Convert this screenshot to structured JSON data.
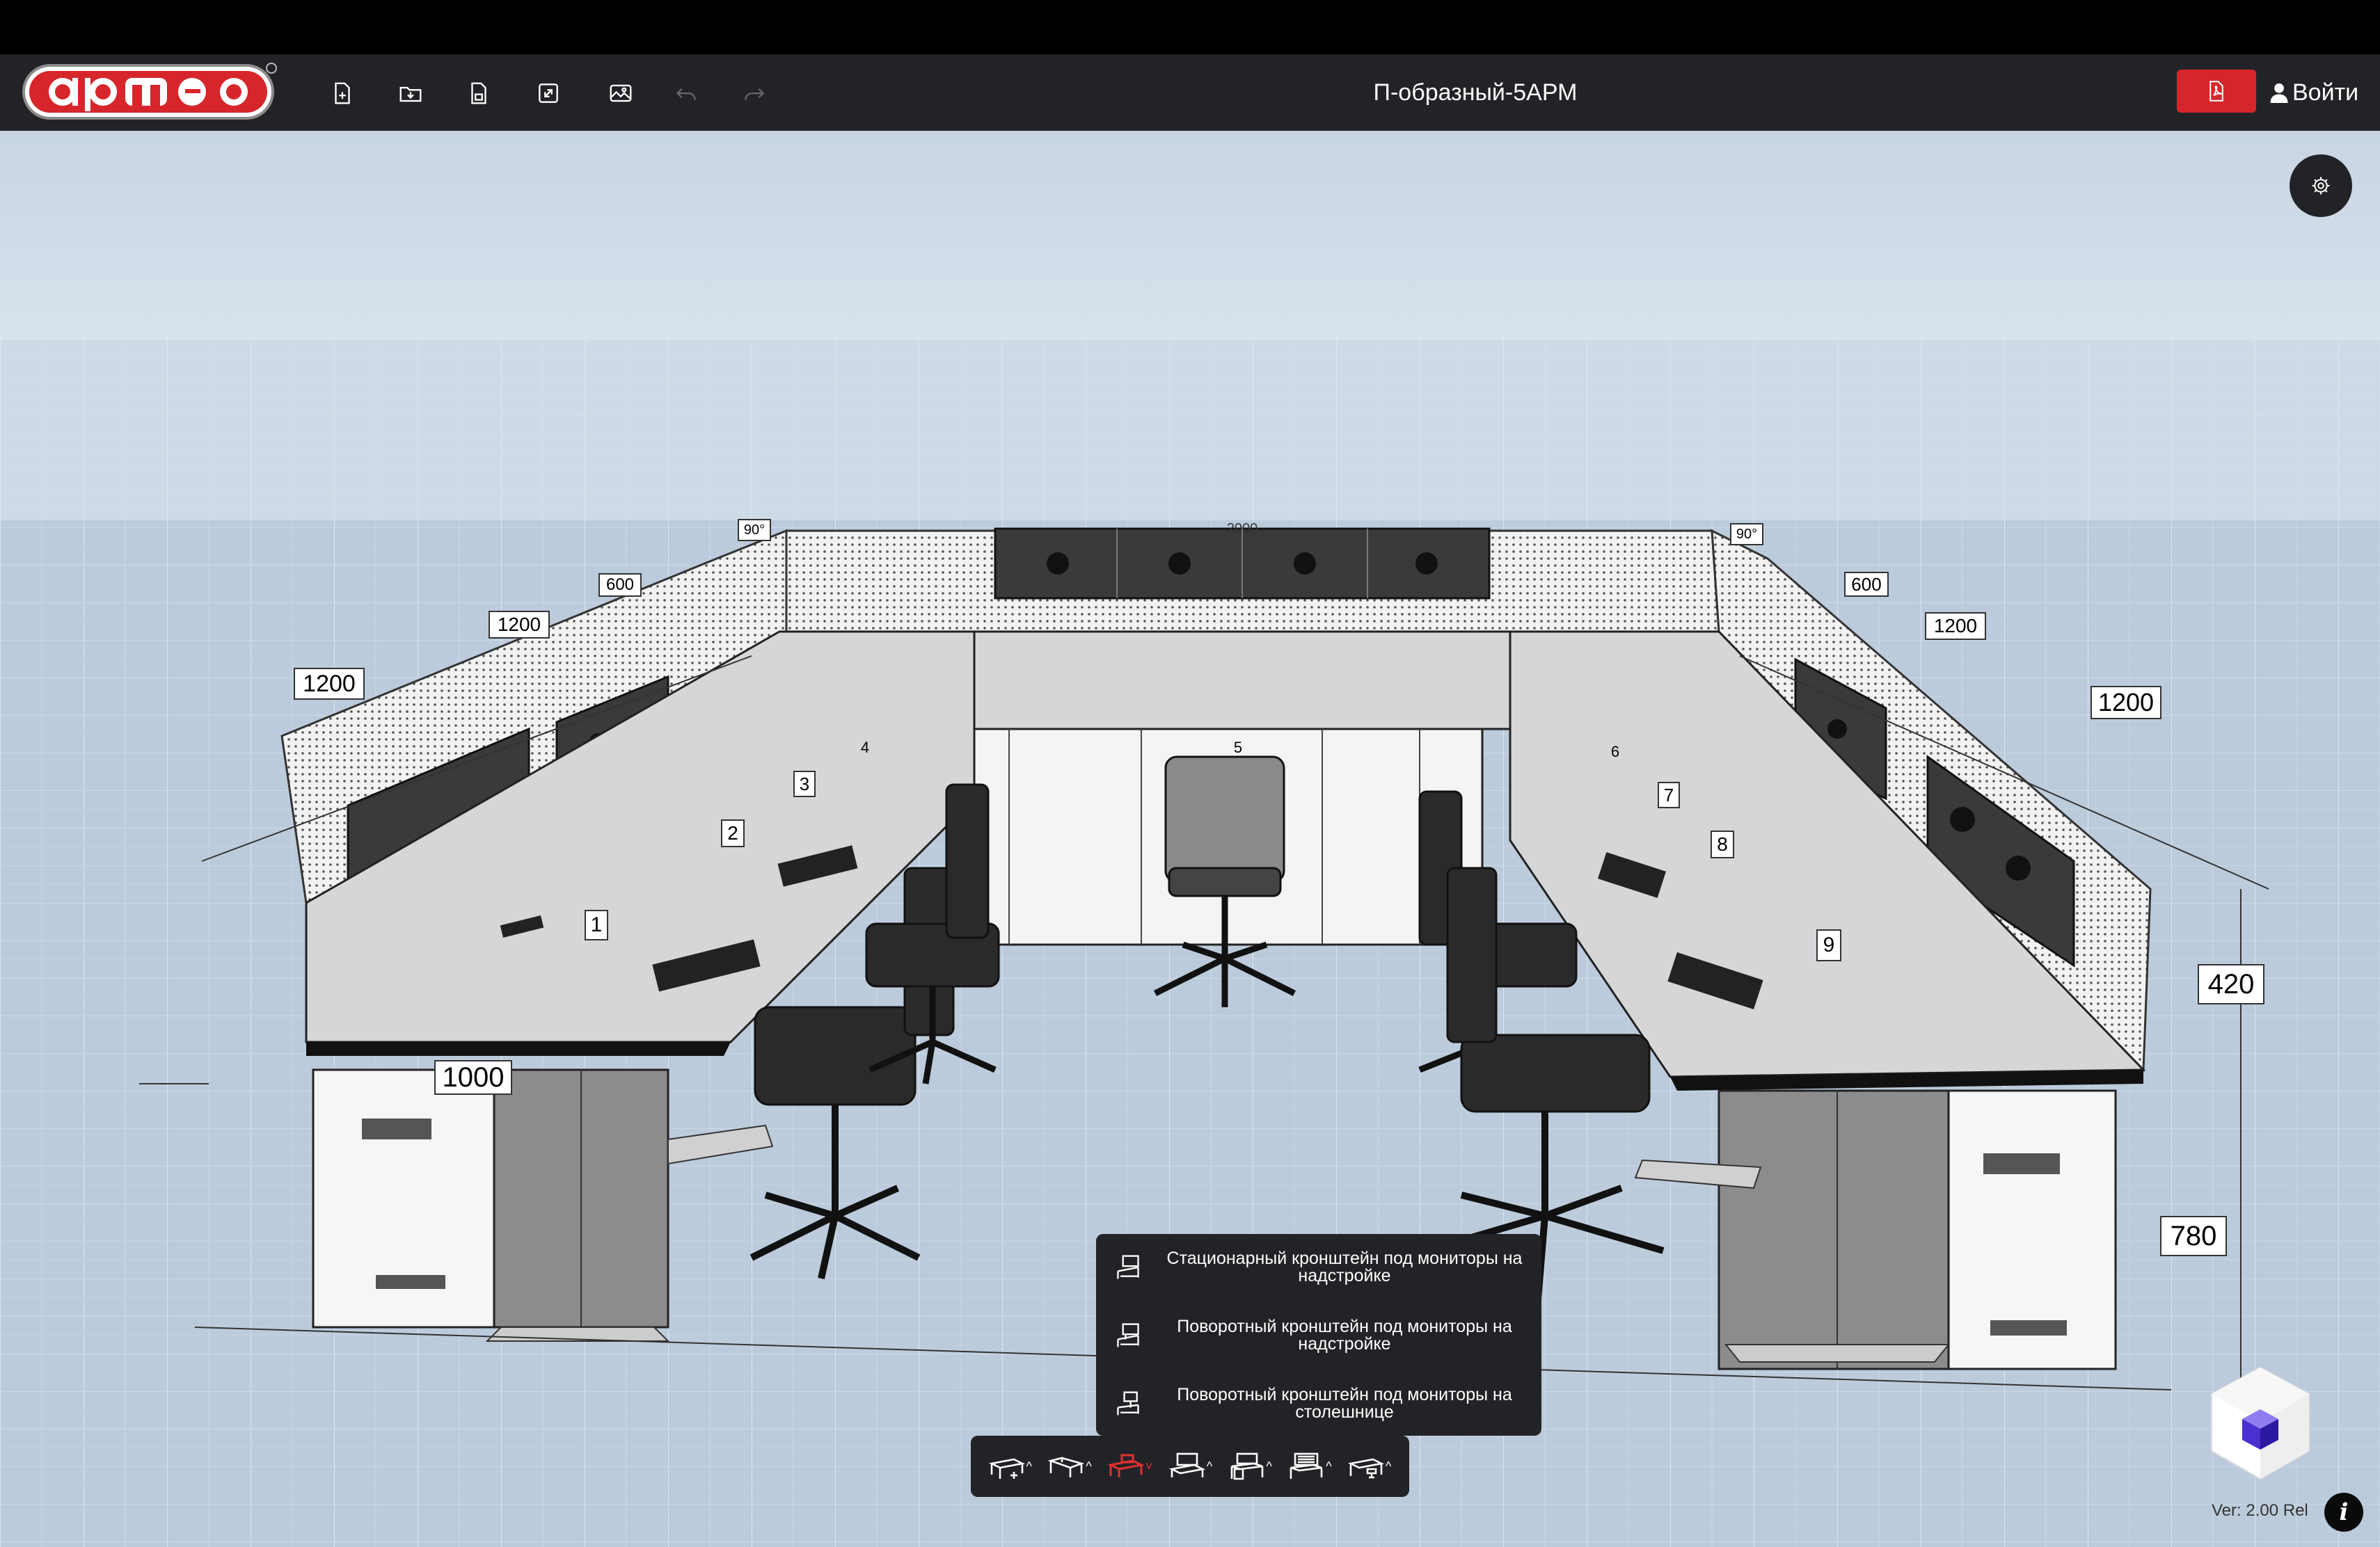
{
  "app": {
    "logo_text": "армео",
    "project_title": "П-образный-5АРМ",
    "login_label": "Войти",
    "version": "Ver: 2.00 Rel",
    "info_glyph": "i"
  },
  "toolbar_top": [
    {
      "name": "new-file-button",
      "icon": "file-plus-icon"
    },
    {
      "name": "open-file-button",
      "icon": "folder-open-icon"
    },
    {
      "name": "save-button",
      "icon": "save-icon"
    },
    {
      "name": "fullscreen-button",
      "icon": "expand-icon"
    },
    {
      "name": "screenshot-button",
      "icon": "image-icon"
    },
    {
      "name": "undo-button",
      "icon": "undo-icon"
    },
    {
      "name": "redo-button",
      "icon": "redo-icon"
    }
  ],
  "dimensions": {
    "left_near": "1200",
    "left_mid": "1200",
    "left_far": "600",
    "angle_left": "90°",
    "right_near": "1200",
    "right_mid": "1200",
    "right_far": "600",
    "angle_right": "90°",
    "front_depth": "1000",
    "height_upper": "420",
    "height_desk": "780",
    "top_width": "2000",
    "workplaces": [
      "1",
      "2",
      "3",
      "4",
      "5",
      "6",
      "7",
      "8",
      "9"
    ]
  },
  "popup_menu": {
    "items": [
      "Стационарный кронштейн под мониторы на надстройке",
      "Поворотный кронштейн под мониторы на надстройке",
      "Поворотный кронштейн под мониторы на столешнице"
    ]
  },
  "bottom_toolbar": {
    "tools": [
      {
        "name": "desk-add-tool",
        "caret": "^"
      },
      {
        "name": "desk-corner-tool",
        "caret": "^"
      },
      {
        "name": "monitor-bracket-tool",
        "caret": "˅",
        "active": true
      },
      {
        "name": "superstructure-tool",
        "caret": "^"
      },
      {
        "name": "cabinet-tool",
        "caret": "^"
      },
      {
        "name": "panel-tool",
        "caret": "^"
      },
      {
        "name": "chair-tool",
        "caret": "^"
      }
    ]
  },
  "colors": {
    "header_bg": "#222326",
    "accent_red": "#d6262b",
    "active_tool": "#e03030"
  }
}
